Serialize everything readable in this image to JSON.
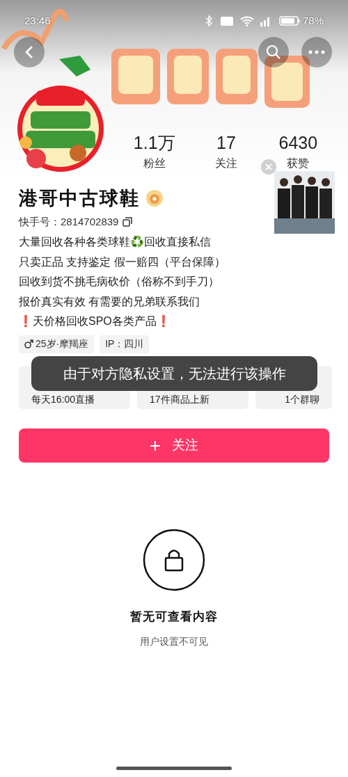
{
  "status_bar": {
    "time": "23:46",
    "battery": "78%"
  },
  "stats": [
    {
      "value": "1.1万",
      "label": "粉丝"
    },
    {
      "value": "17",
      "label": "关注"
    },
    {
      "value": "6430",
      "label": "获赞"
    }
  ],
  "profile": {
    "name": "港哥中古球鞋",
    "id_label": "快手号：2814702839",
    "bio": [
      "大量回收各种各类球鞋♻️回收直接私信",
      "只卖正品 支持鉴定 假一赔四（平台保障）",
      "回收到货不挑毛病砍价（俗称不到手刀）",
      "报价真实有效 有需要的兄弟联系我们",
      "❗天价格回收SPO各类产品❗"
    ],
    "tags": [
      {
        "kind": "gender",
        "text": "25岁·摩羯座"
      },
      {
        "kind": "plain",
        "text": "IP：四川"
      }
    ]
  },
  "cards": [
    {
      "subtitle": "每天16:00直播"
    },
    {
      "subtitle": "17件商品上新"
    },
    {
      "subtitle": "1个群聊"
    }
  ],
  "toast": "由于对方隐私设置，无法进行该操作",
  "follow_button": {
    "icon": "+",
    "label": "关注"
  },
  "empty_state": {
    "title": "暂无可查看内容",
    "subtitle": "用户设置不可见"
  }
}
